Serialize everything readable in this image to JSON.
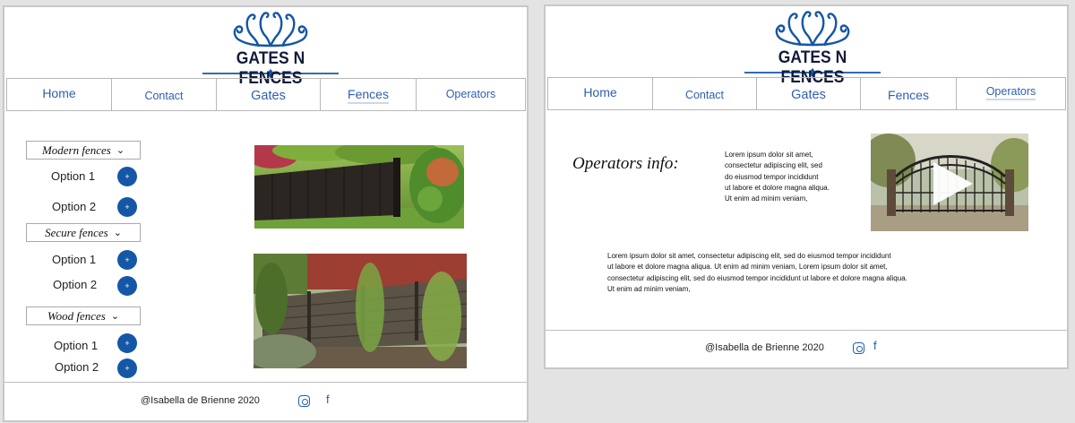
{
  "brand": {
    "name": "GATES N FENCES",
    "logo_color": "#1557a6"
  },
  "nav": [
    {
      "label": "Home"
    },
    {
      "label": "Contact"
    },
    {
      "label": "Gates"
    },
    {
      "label": "Fences"
    },
    {
      "label": "Operators"
    }
  ],
  "fences_page": {
    "sections": [
      {
        "title": "Modern fences",
        "options": [
          "Option 1",
          "Option 2"
        ]
      },
      {
        "title": "Secure fences",
        "options": [
          "Option 1",
          "Option 2"
        ]
      },
      {
        "title": "Wood fences",
        "options": [
          "Option 1",
          "Option 2"
        ]
      }
    ],
    "add_icon": "+"
  },
  "operators_page": {
    "title": "Operators info:",
    "short_text": "Lorem ipsum dolor sit amet,\nconsectetur adipiscing elit, sed\ndo eiusmod tempor incididunt\nut labore et dolore magna aliqua.\n Ut enim ad minim veniam,",
    "long_text": "Lorem ipsum dolor sit amet, consectetur adipiscing elit, sed do eiusmod tempor incididunt\nut labore et dolore magna aliqua. Ut enim ad minim veniam, Lorem ipsum dolor sit amet,\nconsectetur adipiscing elit, sed do eiusmod tempor incididunt ut labore et dolore magna aliqua.\nUt enim ad minim veniam,"
  },
  "footer": {
    "credit": "@Isabella de Brienne 2020",
    "facebook_glyph": "f"
  },
  "colors": {
    "accent": "#1557a6",
    "nav_text": "#2f5fb0"
  }
}
